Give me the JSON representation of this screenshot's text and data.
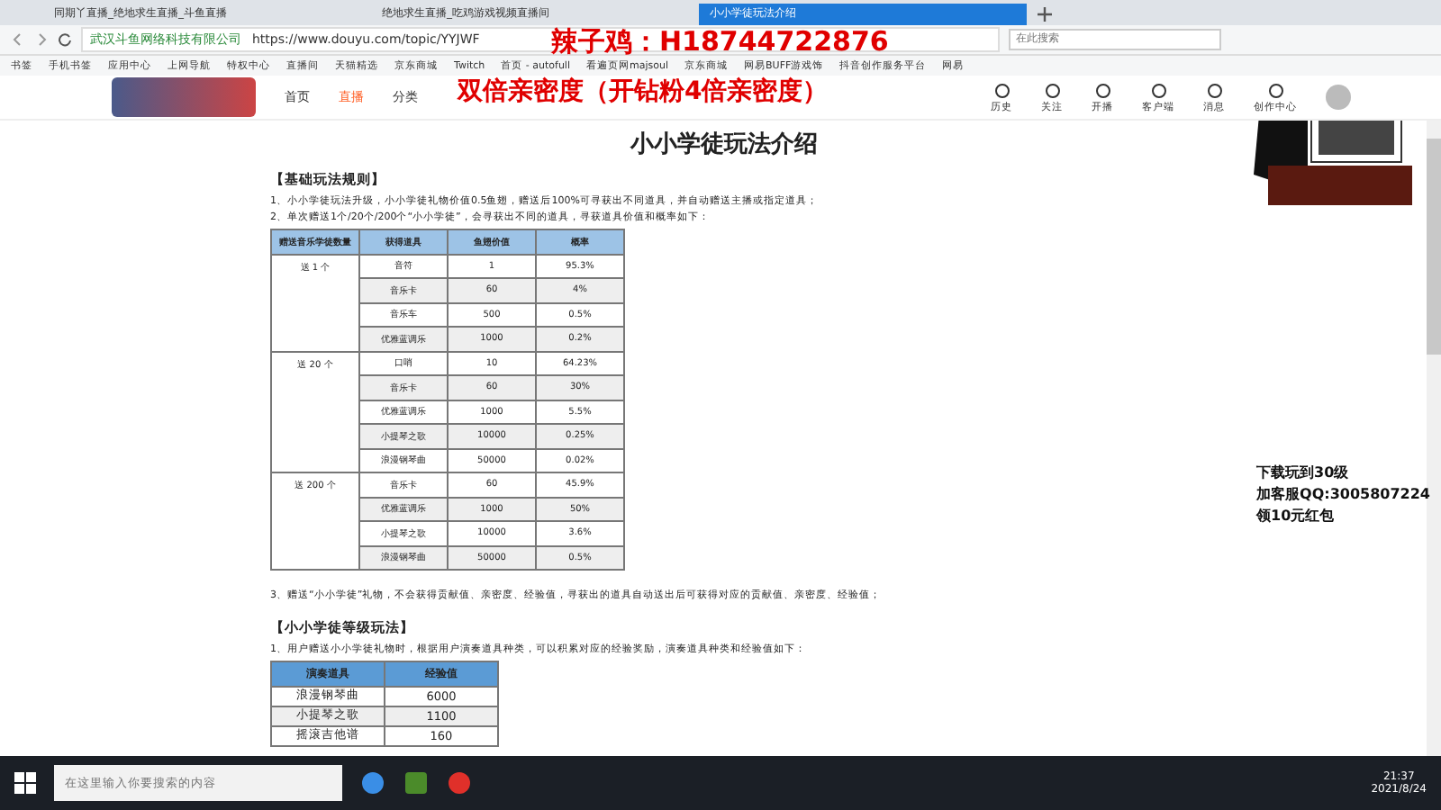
{
  "tabs": [
    {
      "label": "同期丫直播_绝地求生直播_斗鱼直播",
      "selected": false
    },
    {
      "label": "绝地求生直播_吃鸡游戏视频直播间",
      "selected": false
    },
    {
      "label": "小小学徒玩法介绍",
      "selected": true
    }
  ],
  "address_bar": {
    "site": "武汉斗鱼网络科技有限公司",
    "url": "https://www.douyu.com/topic/YYJWF",
    "search_placeholder": "在此搜索"
  },
  "bookmarks": [
    "书签",
    "手机书签",
    "应用中心",
    "上网导航",
    "特权中心",
    "直播间",
    "天猫精选",
    "京东商城",
    "Twitch",
    "首页 - autofull",
    "看遍页网majsoul",
    "京东商城",
    "网易BUFF游戏饰",
    "抖音创作服务平台",
    "网易"
  ],
  "site_nav": {
    "links": [
      {
        "label": "首页",
        "selected": false
      },
      {
        "label": "直播",
        "selected": true
      },
      {
        "label": "分类",
        "selected": false
      }
    ],
    "actions": [
      "历史",
      "关注",
      "开播",
      "客户端",
      "消息",
      "创作中心"
    ]
  },
  "overlay": {
    "contact": "辣子鸡：H18744722876",
    "promo": "双倍亲密度（开钻粉4倍亲密度）",
    "side_lines": [
      "下载玩到30级",
      "加客服QQ:3005807224",
      "领10元红包"
    ]
  },
  "page": {
    "title": "小小学徒玩法介绍",
    "section_1": {
      "heading": "【基础玩法规则】",
      "lines": [
        "1、小小学徒玩法升级，小小学徒礼物价值0.5鱼翅，赠送后100%可寻获出不同道具，并自动赠送主播或指定道具；",
        "2、单次赠送1个/20个/200个“小小学徒”，会寻获出不同的道具，寻获道具价值和概率如下："
      ],
      "table": {
        "columns": [
          "赠送音乐学徒数量",
          "获得道具",
          "鱼翅价值",
          "概率"
        ],
        "groups": [
          {
            "label": "送 1 个",
            "rows": [
              [
                "音符",
                "1",
                "95.3%"
              ],
              [
                "音乐卡",
                "60",
                "4%"
              ],
              [
                "音乐车",
                "500",
                "0.5%"
              ],
              [
                "优雅蓝调乐",
                "1000",
                "0.2%"
              ]
            ]
          },
          {
            "label": "送 20 个",
            "rows": [
              [
                "口哨",
                "10",
                "64.23%"
              ],
              [
                "音乐卡",
                "60",
                "30%"
              ],
              [
                "优雅蓝调乐",
                "1000",
                "5.5%"
              ],
              [
                "小提琴之歌",
                "10000",
                "0.25%"
              ],
              [
                "浪漫钢琴曲",
                "50000",
                "0.02%"
              ]
            ]
          },
          {
            "label": "送 200 个",
            "rows": [
              [
                "音乐卡",
                "60",
                "45.9%"
              ],
              [
                "优雅蓝调乐",
                "1000",
                "50%"
              ],
              [
                "小提琴之歌",
                "10000",
                "3.6%"
              ],
              [
                "浪漫钢琴曲",
                "50000",
                "0.5%"
              ]
            ]
          }
        ]
      },
      "note": "3、赠送“小小学徒”礼物，不会获得贡献值、亲密度、经验值，寻获出的道具自动送出后可获得对应的贡献值、亲密度、经验值；"
    },
    "section_2": {
      "heading": "【小小学徒等级玩法】",
      "line": "1、用户赠送小小学徒礼物时，根据用户演奏道具种类，可以积累对应的经验奖励，演奏道具种类和经验值如下：",
      "table": {
        "columns": [
          "演奏道具",
          "经验值"
        ],
        "rows": [
          [
            "浪漫钢琴曲",
            "6000"
          ],
          [
            "小提琴之歌",
            "1100"
          ],
          [
            "摇滚吉他谱",
            "160"
          ]
        ]
      }
    }
  },
  "taskbar": {
    "search_placeholder": "在这里输入你要搜索的内容",
    "time": "21:37",
    "date": "2021/8/24"
  }
}
